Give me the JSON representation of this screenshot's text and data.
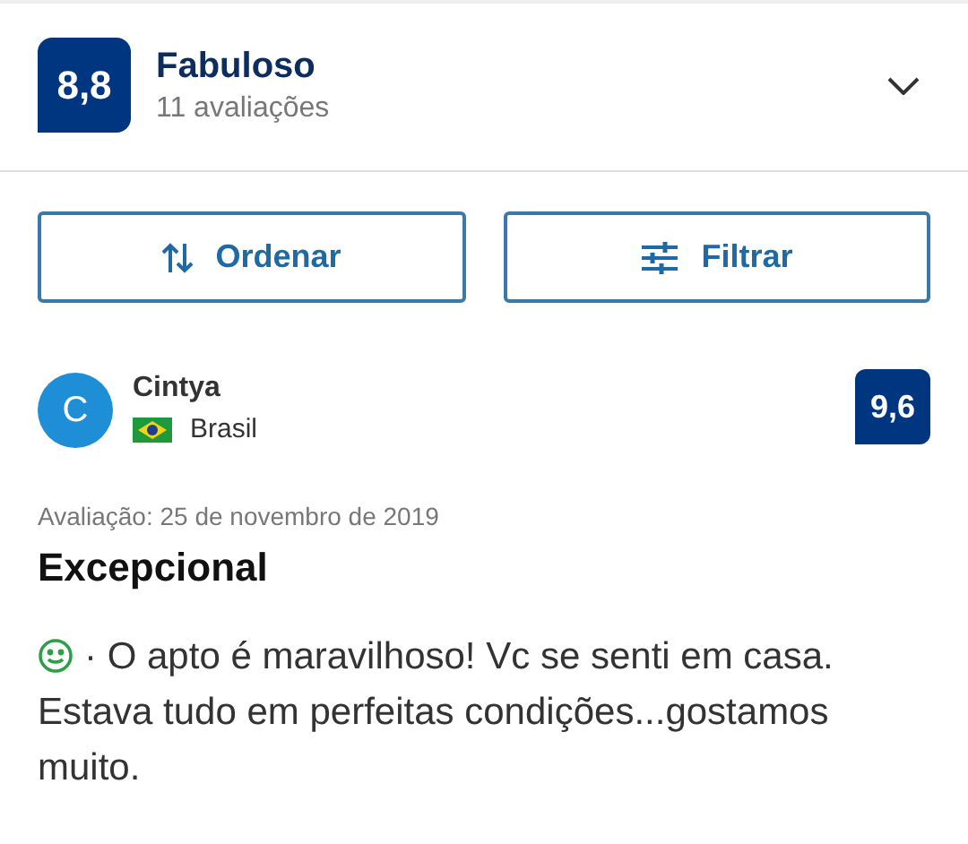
{
  "summary": {
    "score": "8,8",
    "label": "Fabuloso",
    "count": "11 avaliações"
  },
  "actions": [
    {
      "kind": "sort",
      "label": "Ordenar"
    },
    {
      "kind": "filter",
      "label": "Filtrar"
    }
  ],
  "review": {
    "initial": "C",
    "name": "Cintya",
    "country": "Brasil",
    "score": "9,6",
    "date": "Avaliação: 25 de novembro de 2019",
    "title": "Excepcional",
    "text": "· O apto é maravilhoso! Vc se senti em casa. Estava tudo em perfeitas condições...gostamos muito."
  }
}
